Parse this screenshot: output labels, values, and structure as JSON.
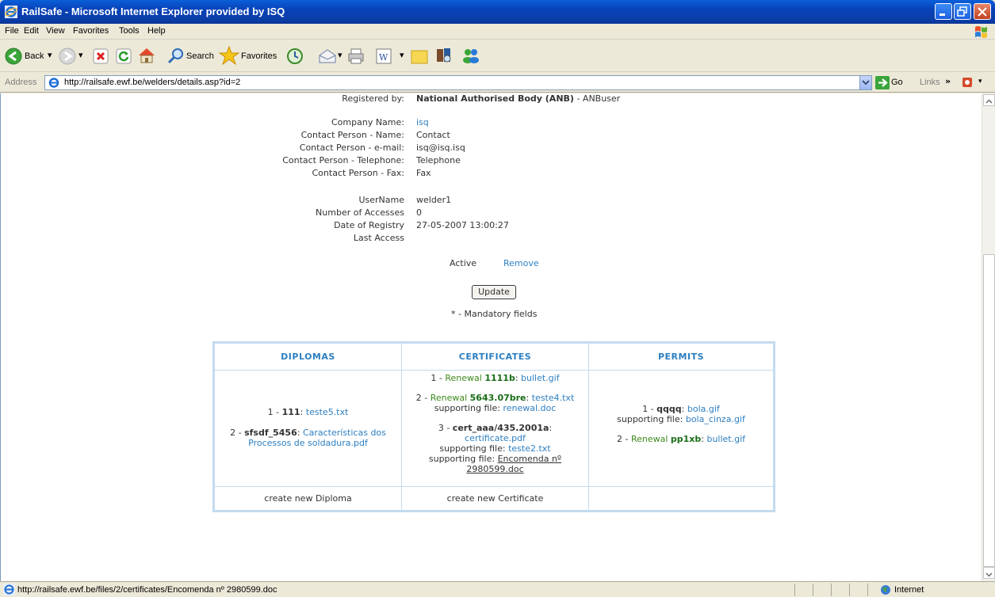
{
  "window": {
    "title": "RailSafe - Microsoft Internet Explorer provided by ISQ"
  },
  "menu": [
    "File",
    "Edit",
    "View",
    "Favorites",
    "Tools",
    "Help"
  ],
  "toolbar": {
    "back_label": "Back",
    "search_label": "Search",
    "favorites_label": "Favorites"
  },
  "address": {
    "label": "Address",
    "url": "http://railsafe.ewf.be/welders/details.asp?id=2",
    "go_label": "Go",
    "links_label": "Links"
  },
  "details": {
    "registered_by_label": "Registered by:",
    "registered_by_body": "National Authorised Body (ANB)",
    "registered_by_user": " - ANBuser",
    "company_name_label": "Company Name:",
    "company_name": "isq",
    "contact_name_label": "Contact Person - Name:",
    "contact_name": "Contact",
    "contact_email_label": "Contact Person - e-mail:",
    "contact_email": "isq@isq.isq",
    "contact_phone_label": "Contact Person - Telephone:",
    "contact_phone": "Telephone",
    "contact_fax_label": "Contact Person - Fax:",
    "contact_fax": "Fax",
    "username_label": "UserName",
    "username": "welder1",
    "accesses_label": "Number of Accesses",
    "accesses": "0",
    "registry_label": "Date of Registry",
    "registry": "27-05-2007 13:00:27",
    "last_access_label": "Last Access",
    "active_label": "Active",
    "remove_link": "Remove",
    "update_button": "Update",
    "mandatory_note": "* - Mandatory fields"
  },
  "table": {
    "headers": [
      "DIPLOMAS",
      "CERTIFICATES",
      "PERMITS"
    ],
    "diplomas": {
      "d1_num": "1 - ",
      "d1_code": "111",
      "d1_sep": ": ",
      "d1_file": "teste5.txt",
      "d2_num": "2 - ",
      "d2_code": "sfsdf_5456",
      "d2_sep": ": ",
      "d2_file_line1": "Características dos",
      "d2_file_line2": "Processos de soldadura.pdf"
    },
    "certificates": {
      "c1_num": "1 - ",
      "c1_renewal": "Renewal ",
      "c1_code": "1111b",
      "c1_sep": ": ",
      "c1_file": "bullet.gif",
      "c2_num": "2 - ",
      "c2_renewal": "Renewal ",
      "c2_code": "5643.07bre",
      "c2_sep": ": ",
      "c2_file": "teste4.txt",
      "c2_support_label": "supporting file: ",
      "c2_support_file": "renewal.doc",
      "c3_num": "3 - ",
      "c3_code": "cert_aaa/435.2001a",
      "c3_sep": ":",
      "c3_file": "certificate.pdf",
      "c3_support1_label": "supporting file: ",
      "c3_support1_file": "teste2.txt",
      "c3_support2_label": "supporting file: ",
      "c3_support2_file_line1": "Encomenda nº",
      "c3_support2_file_line2": "2980599.doc"
    },
    "permits": {
      "p1_num": "1 - ",
      "p1_code": "qqqq",
      "p1_sep": ": ",
      "p1_file": "bola.gif",
      "p1_support_label": "supporting file: ",
      "p1_support_file": "bola_cinza.gif",
      "p2_num": "2 - ",
      "p2_renewal": "Renewal ",
      "p2_code": "pp1xb",
      "p2_sep": ": ",
      "p2_file": "bullet.gif"
    },
    "footer": [
      "create new Diploma",
      "create new Certificate",
      ""
    ]
  },
  "status": {
    "text": "http://railsafe.ewf.be/files/2/certificates/Encomenda nº 2980599.doc",
    "zone": "Internet"
  }
}
